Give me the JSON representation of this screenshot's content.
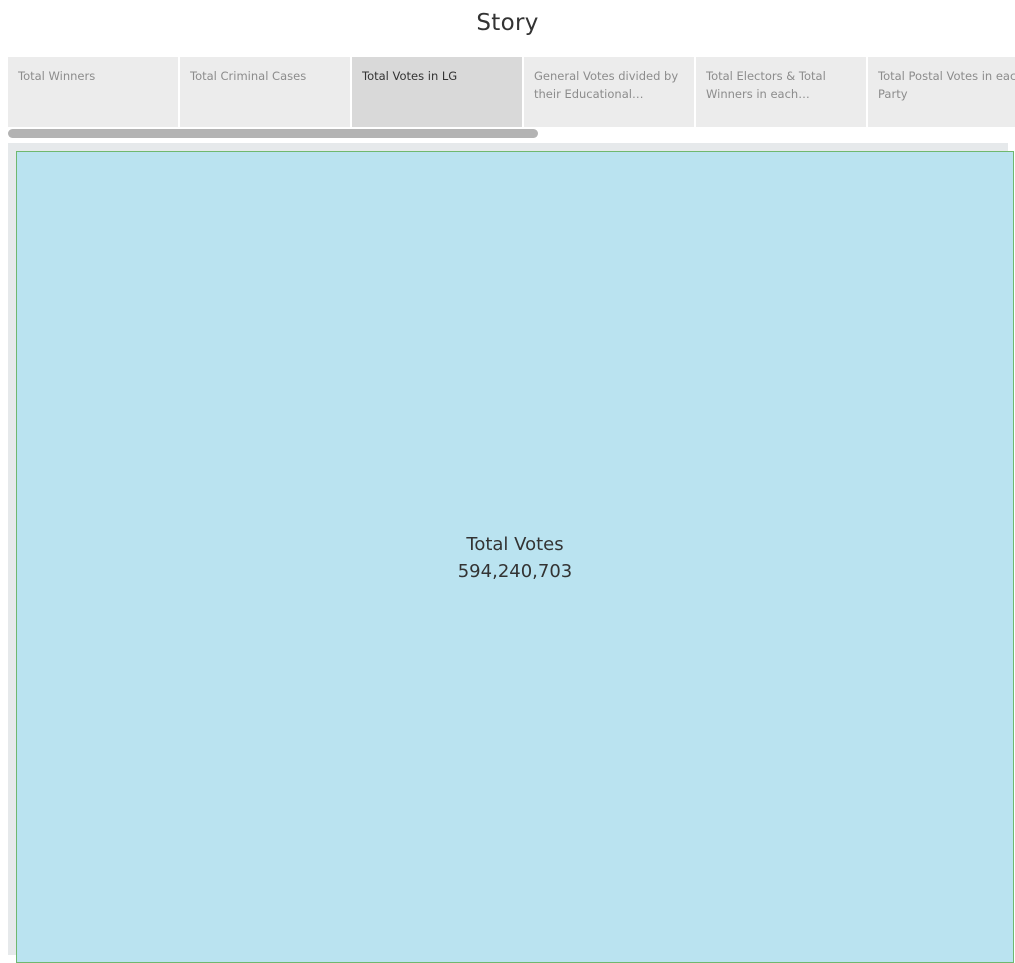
{
  "story": {
    "title": "Story"
  },
  "tabs": [
    {
      "label": "Total Winners",
      "active": false
    },
    {
      "label": "Total Criminal Cases",
      "active": false
    },
    {
      "label": "Total Votes in LG",
      "active": true
    },
    {
      "label": "General Votes divided by their Educational Qualific..",
      "active": false
    },
    {
      "label": "Total Electors & Total Winners in each Constitu..",
      "active": false
    },
    {
      "label": "Total Postal Votes in each Party",
      "active": false
    }
  ],
  "viz": {
    "measure_name": "Total Votes",
    "measure_value": "594,240,703",
    "fill_color": "#bae3f0",
    "border_color": "#6fb86f"
  }
}
